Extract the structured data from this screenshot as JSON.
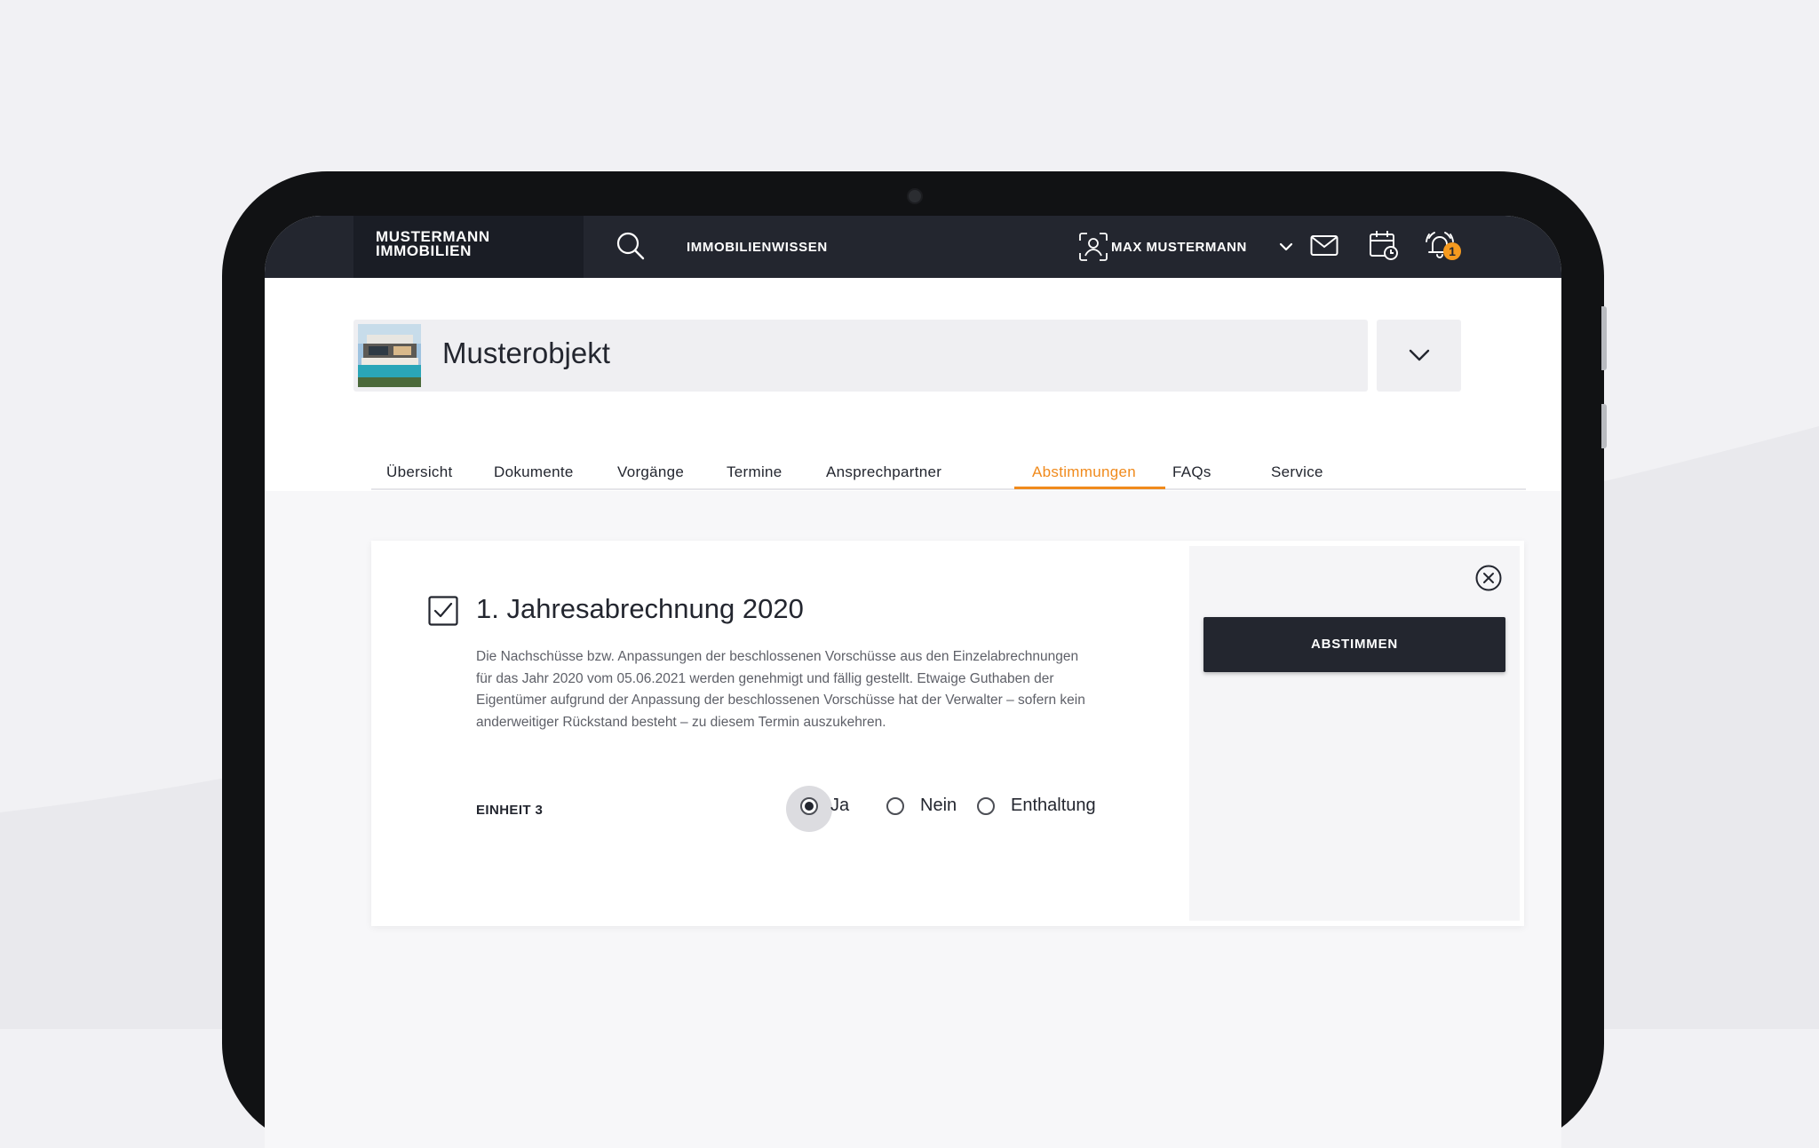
{
  "topbar": {
    "brand_line1": "MUSTERMANN",
    "brand_line2": "IMMOBILIEN",
    "search_icon": "search-icon",
    "nav_link": "IMMOBILIENWISSEN",
    "user_icon": "face-scan-icon",
    "user_name": "MAX MUSTERMANN",
    "mail_icon": "mail-icon",
    "calendar_icon": "calendar-clock-icon",
    "bell_icon": "alarm-bell-icon",
    "notification_count": "1"
  },
  "object": {
    "name": "Musterobjekt",
    "thumbnail": "house-photo"
  },
  "tabs": [
    {
      "label": "Übersicht"
    },
    {
      "label": "Dokumente"
    },
    {
      "label": "Vorgänge"
    },
    {
      "label": "Termine"
    },
    {
      "label": "Ansprechpartner"
    },
    {
      "label": "Abstimmungen"
    },
    {
      "label": "FAQs"
    },
    {
      "label": "Service"
    }
  ],
  "active_tab": "Abstimmungen",
  "vote": {
    "title": "1. Jahresabrechnung 2020",
    "description": "Die Nachschüsse bzw. Anpassungen der beschlossenen Vorschüsse aus den Einzelabrechnungen für das Jahr 2020 vom 05.06.2021 werden genehmigt und fällig gestellt. Etwaige Guthaben der Eigentümer aufgrund der Anpassung der beschlossenen Vorschüsse hat der Verwalter – sofern kein anderweitiger Rückstand besteht – zu diesem Termin auszukehren.",
    "unit_label": "EINHEIT 3",
    "options": [
      {
        "label": "Ja"
      },
      {
        "label": "Nein"
      },
      {
        "label": "Enthaltung"
      }
    ],
    "selected": "Ja",
    "submit_label": "ABSTIMMEN"
  },
  "colors": {
    "navy": "#23262f",
    "accent": "#f08a1c",
    "badge": "#f59a1f"
  }
}
